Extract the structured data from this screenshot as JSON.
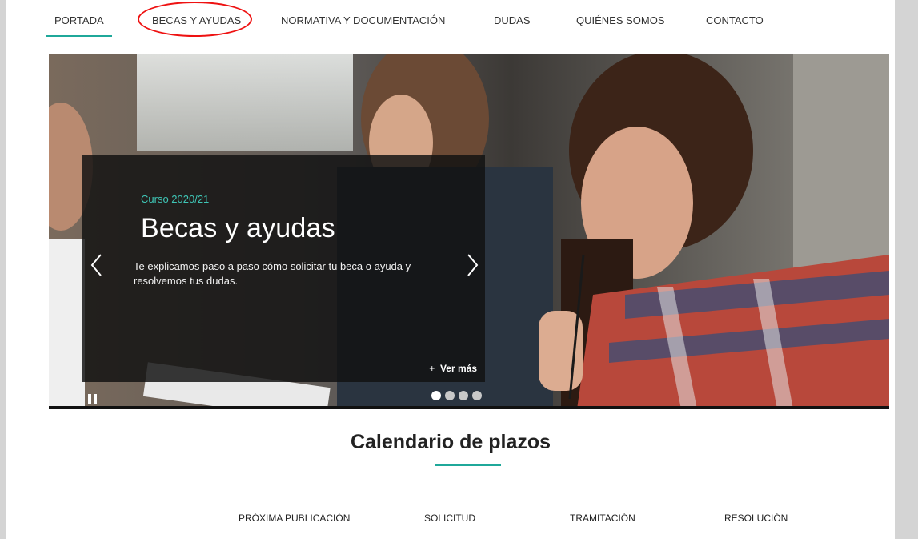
{
  "nav": {
    "items": [
      "PORTADA",
      "BECAS Y AYUDAS",
      "NORMATIVA Y DOCUMENTACIÓN",
      "DUDAS",
      "QUIÉNES SOMOS",
      "CONTACTO"
    ],
    "active": "PORTADA"
  },
  "hero": {
    "kicker": "Curso 2020/21",
    "title": "Becas y ayudas",
    "text": "Te explicamos paso a paso cómo solicitar tu beca o ayuda y resolvemos tus dudas.",
    "more_plus": "+",
    "more_label": "Ver más",
    "prev_icon": "chevron-left-icon",
    "next_icon": "chevron-right-icon",
    "pause_icon": "pause-icon",
    "slides_total": 4,
    "slide_active": 1
  },
  "calendar": {
    "title": "Calendario de plazos",
    "columns": [
      "PRÓXIMA PUBLICACIÓN",
      "SOLICITUD",
      "TRAMITACIÓN",
      "RESOLUCIÓN"
    ]
  },
  "colors": {
    "accent": "#1fa89a",
    "kicker": "#3fc6b6",
    "annotation": "#e11111"
  }
}
